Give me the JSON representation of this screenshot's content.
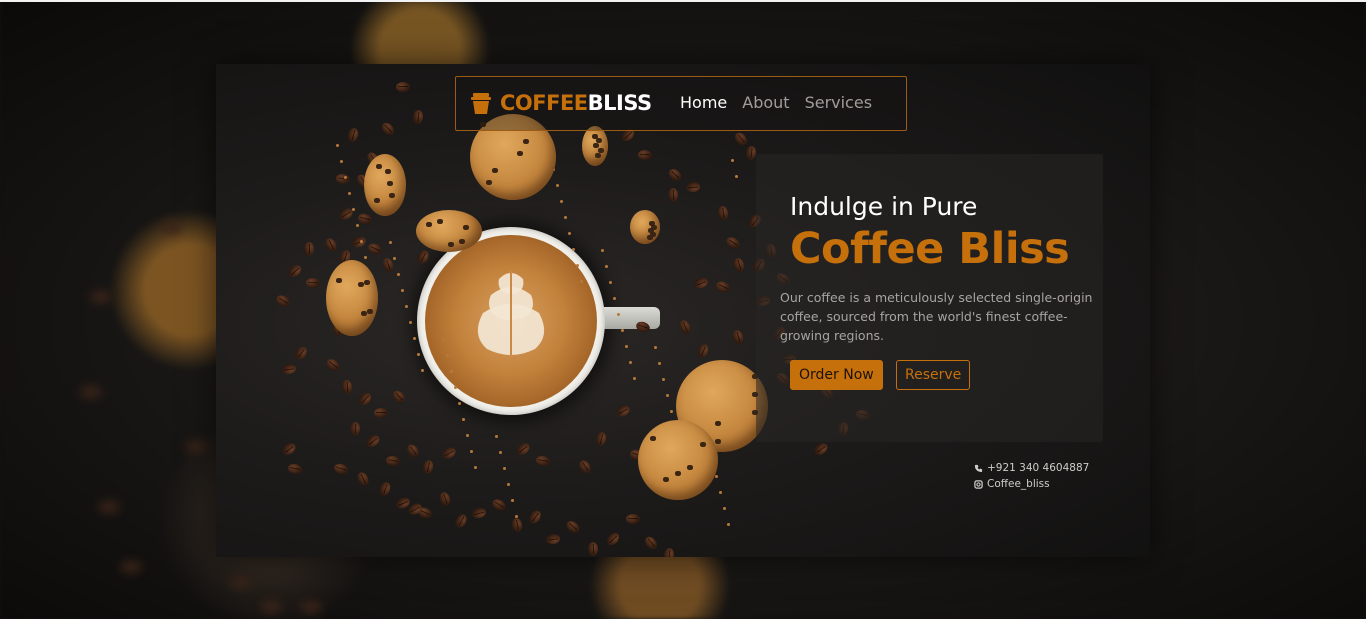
{
  "brand": {
    "name_part1": "COFFEE",
    "name_part2": "BLISS",
    "logo_icon": "coffee-cup-icon",
    "accent_color": "#c6700c"
  },
  "nav": {
    "links": [
      {
        "label": "Home",
        "active": true
      },
      {
        "label": "About",
        "active": false
      },
      {
        "label": "Services",
        "active": false
      }
    ]
  },
  "hero": {
    "line1": "Indulge in Pure",
    "line2": "Coffee Bliss",
    "description": "Our coffee is a meticulously selected single-origin coffee, sourced from the world's finest coffee-growing regions.",
    "primary_button": "Order Now",
    "secondary_button": "Reserve"
  },
  "contact": {
    "phone": "+921 340 4604887",
    "phone_icon": "phone-icon",
    "instagram": "Coffee_bliss",
    "instagram_icon": "instagram-icon"
  }
}
